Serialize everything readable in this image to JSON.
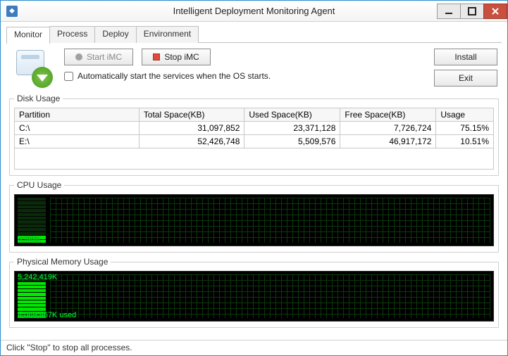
{
  "window": {
    "title": "Intelligent Deployment Monitoring Agent"
  },
  "tabs": [
    {
      "label": "Monitor",
      "active": true
    },
    {
      "label": "Process",
      "active": false
    },
    {
      "label": "Deploy",
      "active": false
    },
    {
      "label": "Environment",
      "active": false
    }
  ],
  "controls": {
    "start_label": "Start iMC",
    "stop_label": "Stop iMC",
    "autostart_label": "Automatically start the services when the OS starts.",
    "install_label": "Install",
    "exit_label": "Exit"
  },
  "disk": {
    "legend": "Disk Usage",
    "columns": [
      "Partition",
      "Total Space(KB)",
      "Used Space(KB)",
      "Free Space(KB)",
      "Usage"
    ],
    "rows": [
      {
        "partition": "C:\\",
        "total": "31,097,852",
        "used": "23,371,128",
        "free": "7,726,724",
        "usage": "75.15%"
      },
      {
        "partition": "E:\\",
        "total": "52,426,748",
        "used": "5,509,576",
        "free": "46,917,172",
        "usage": "10.51%"
      }
    ]
  },
  "cpu": {
    "legend": "CPU Usage",
    "value_label": "0.58%",
    "bars_on": 2,
    "bars_total": 12
  },
  "memory": {
    "legend": "Physical Memory Usage",
    "top_label": "5,242,419K",
    "bottom_label": "4,069,867K used",
    "bars_on": 10,
    "bars_total": 12
  },
  "statusbar": {
    "text": "Click \"Stop\" to stop all processes."
  }
}
